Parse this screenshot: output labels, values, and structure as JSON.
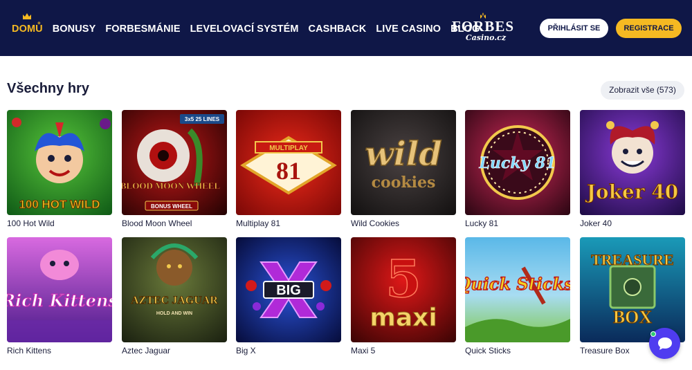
{
  "nav": {
    "items": [
      {
        "label": "DOMŮ",
        "active": true
      },
      {
        "label": "BONUSY"
      },
      {
        "label": "FORBESMÁNIE"
      },
      {
        "label": "LEVELOVACÍ SYSTÉM"
      },
      {
        "label": "CASHBACK"
      },
      {
        "label": "LIVE CASINO"
      },
      {
        "label": "BLOG"
      }
    ],
    "logo_text": "FORBES",
    "logo_sub": "Casino.cz"
  },
  "auth": {
    "login_label": "PŘIHLÁSIT SE",
    "register_label": "REGISTRACE"
  },
  "section": {
    "title": "Všechny hry",
    "show_all_label": "Zobrazit vše (573)"
  },
  "games": [
    {
      "name": "100 Hot Wild",
      "art": "100 HOT WILD",
      "colors": [
        "#3fa32c",
        "#0f5a16"
      ]
    },
    {
      "name": "Blood Moon Wheel",
      "art": "BLOOD MOON WHEEL",
      "badge": "3x5 25 LINES",
      "sub": "BONUS WHEEL",
      "colors": [
        "#8a0a0a",
        "#220202"
      ]
    },
    {
      "name": "Multiplay 81",
      "art": "81",
      "sub": "MULTIPLAY",
      "colors": [
        "#d41a14",
        "#7a0806"
      ]
    },
    {
      "name": "Wild Cookies",
      "art": "wild",
      "sub": "cookies",
      "colors": [
        "#3a3434",
        "#121010"
      ]
    },
    {
      "name": "Lucky 81",
      "art": "Lucky 81",
      "colors": [
        "#9b1034",
        "#2a0612"
      ]
    },
    {
      "name": "Joker 40",
      "art": "Joker 40",
      "colors": [
        "#6a2ab8",
        "#1d0b44"
      ]
    },
    {
      "name": "Rich Kittens",
      "art": "Rich Kittens",
      "colors": [
        "#c64fd6",
        "#4a1a8a"
      ]
    },
    {
      "name": "Aztec Jaguar",
      "art": "AZTEC JAGUAR",
      "sub": "HOLD AND WIN",
      "colors": [
        "#4a5a2a",
        "#1a2010"
      ]
    },
    {
      "name": "Big X",
      "art": "BIG",
      "colors": [
        "#1a3aa0",
        "#060c3a"
      ]
    },
    {
      "name": "Maxi 5",
      "art": "maxi",
      "sub": "5",
      "colors": [
        "#c01212",
        "#3a0404"
      ]
    },
    {
      "name": "Quick Sticks",
      "art": "Quick Sticks",
      "colors": [
        "#3fa0d8",
        "#7fc84a"
      ]
    },
    {
      "name": "Treasure Box",
      "art": "TREASURE",
      "sub": "BOX",
      "colors": [
        "#1a8aa6",
        "#0a2a5a"
      ]
    }
  ]
}
